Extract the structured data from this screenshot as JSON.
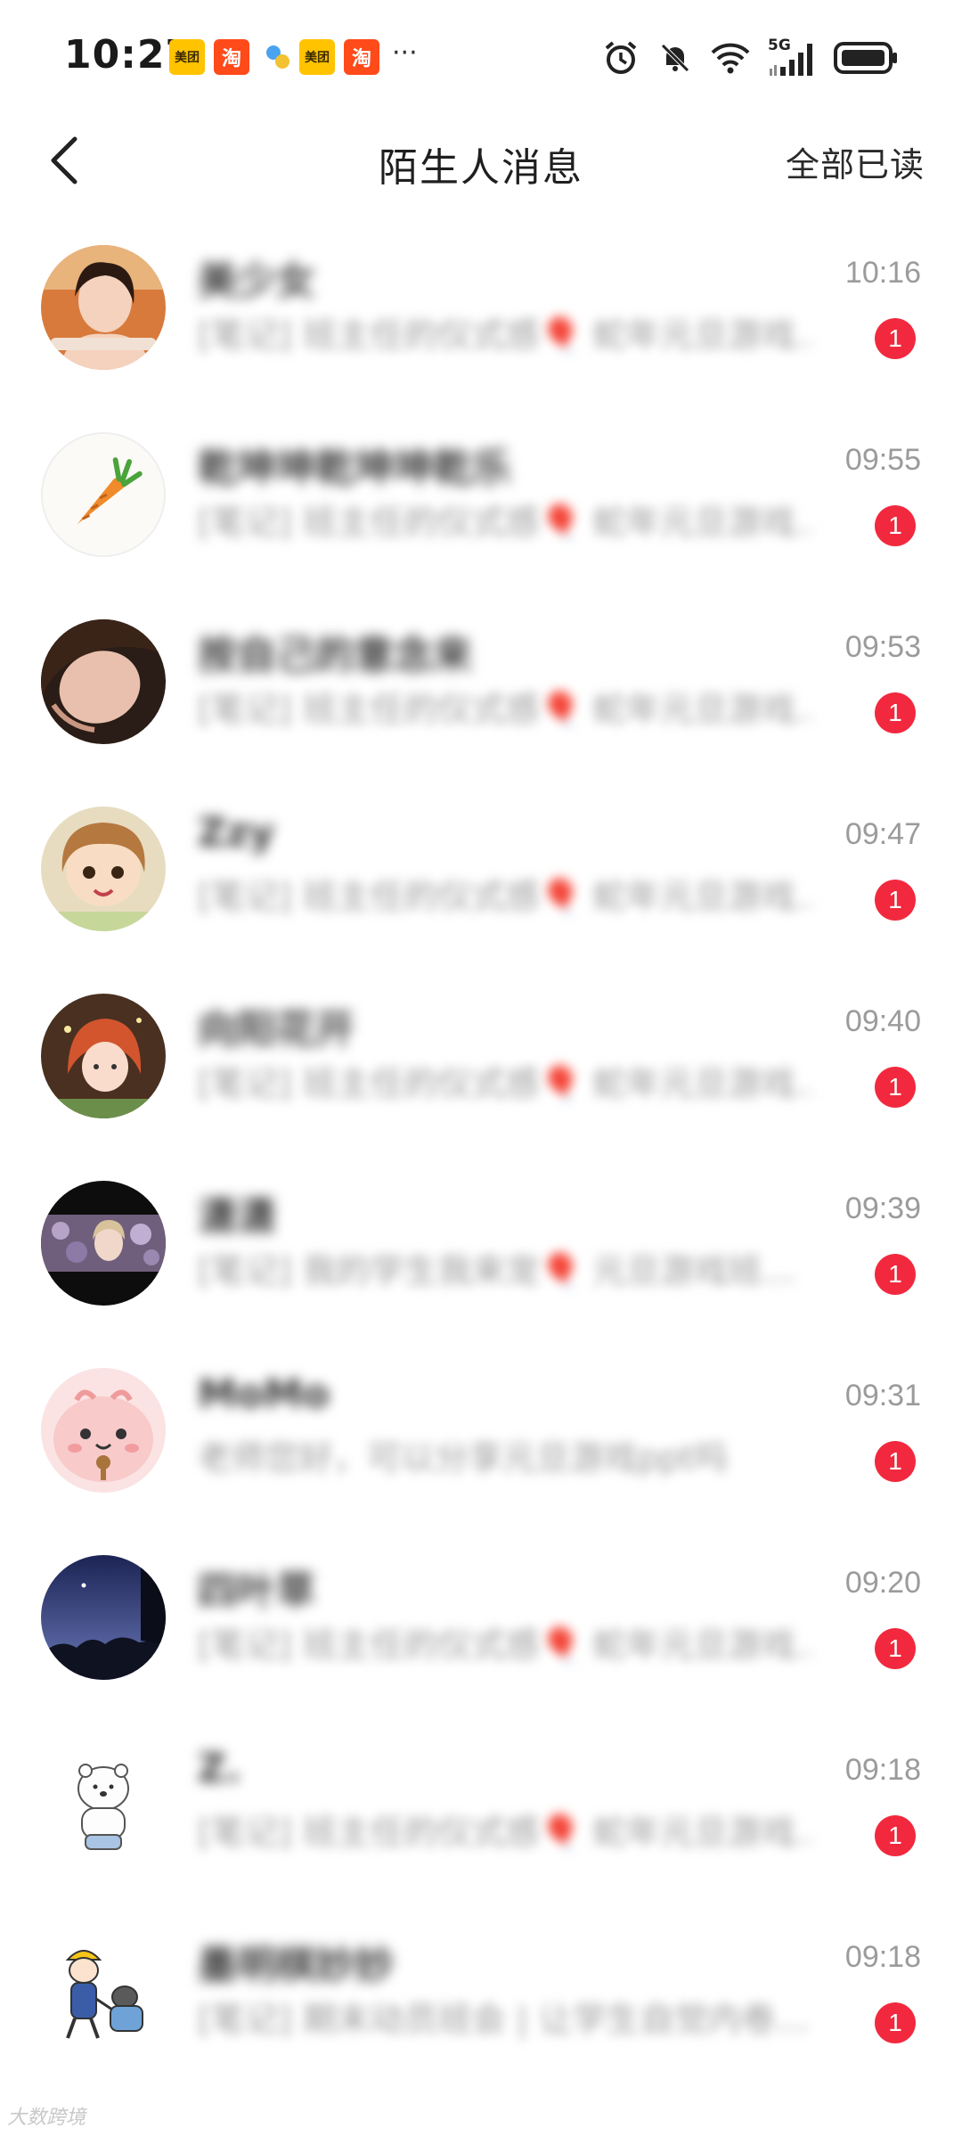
{
  "status_bar": {
    "time": "10:27",
    "apps": [
      "美团",
      "淘",
      "美团",
      "淘"
    ],
    "more": "···",
    "network": "5G"
  },
  "header": {
    "title": "陌生人消息",
    "mark_all_read": "全部已读"
  },
  "messages": [
    {
      "name": "美少女",
      "preview": "[笔记] 班主任的仪式感🎈 蛇年元旦游戏…",
      "time": "10:16",
      "unread": "1",
      "avatar_bg": "#d77a3c"
    },
    {
      "name": "乾坤坤乾坤坤乾乐",
      "preview": "[笔记] 班主任的仪式感🎈 蛇年元旦游戏…",
      "time": "09:55",
      "unread": "1",
      "avatar_bg": "#f7f4ee"
    },
    {
      "name": "按自己的意念来",
      "preview": "[笔记] 班主任的仪式感🎈 蛇年元旦游戏…",
      "time": "09:53",
      "unread": "1",
      "avatar_bg": "#7a5540"
    },
    {
      "name": "Zzy",
      "preview": "[笔记] 班主任的仪式感🎈 蛇年元旦游戏…",
      "time": "09:47",
      "unread": "1",
      "avatar_bg": "#d8c9a3"
    },
    {
      "name": "向阳花开",
      "preview": "[笔记] 班主任的仪式感🎈 蛇年元旦游戏…",
      "time": "09:40",
      "unread": "1",
      "avatar_bg": "#5a3a24"
    },
    {
      "name": "潇潇",
      "preview": "[笔记] 我的学生我来宠🎈 元旦游戏班…",
      "time": "09:39",
      "unread": "1",
      "avatar_bg": "#1a1a1a"
    },
    {
      "name": "MoMo",
      "preview": "老师您好，可以分享元旦游戏ppt吗",
      "time": "09:31",
      "unread": "1",
      "avatar_bg": "#f9c4c4"
    },
    {
      "name": "四叶草",
      "preview": "[笔记] 班主任的仪式感🎈 蛇年元旦游戏…",
      "time": "09:20",
      "unread": "1",
      "avatar_bg": "#2a3565"
    },
    {
      "name": "Z.",
      "preview": "[笔记] 班主任的仪式感🎈 蛇年元旦游戏…",
      "time": "09:18",
      "unread": "1",
      "avatar_bg": "#ffffff"
    },
    {
      "name": "墨明棋妙妙",
      "preview": "[笔记] 期末动员班会 | 让学生自觉内卷…",
      "time": "09:18",
      "unread": "1",
      "avatar_bg": "#ffffff"
    }
  ],
  "watermark": "大数跨境",
  "colors": {
    "badge": "#f2293e",
    "time_text": "#9b9b9b"
  }
}
